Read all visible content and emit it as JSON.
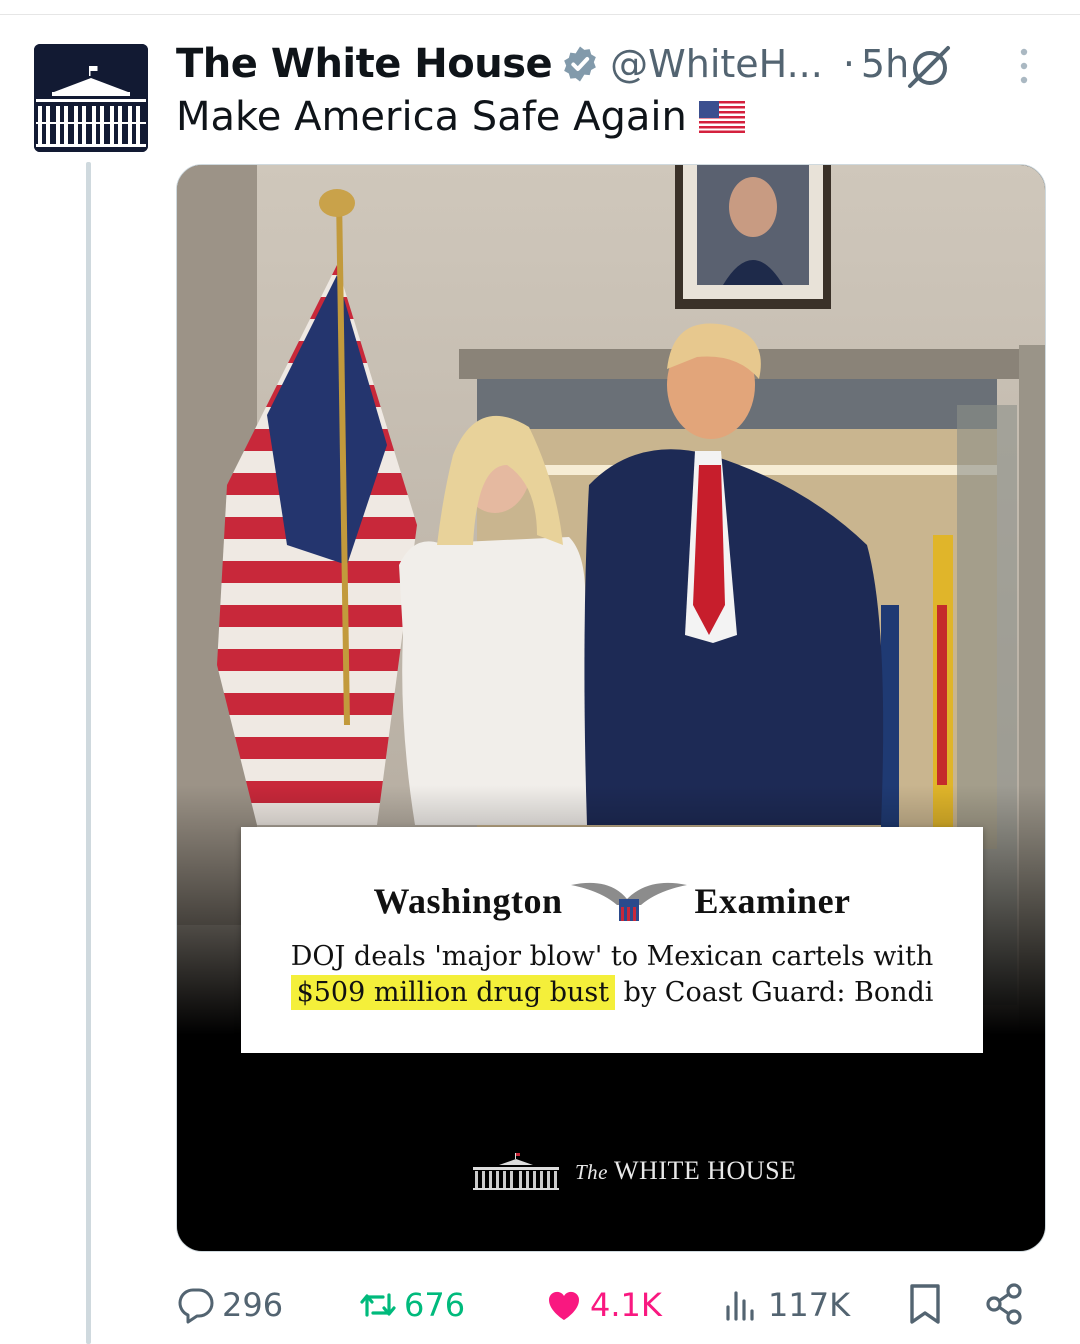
{
  "tweet": {
    "display_name": "The White House",
    "handle": "@WhiteH...",
    "separator": "·",
    "time": "5h",
    "text": "Make America Safe Again",
    "verified_icon": "verified-badge-icon",
    "emoji": "us-flag-icon"
  },
  "media": {
    "masthead_left": "Washington",
    "masthead_right": "Examiner",
    "headline_line1": "DOJ deals 'major blow' to Mexican cartels with",
    "headline_highlight": "$509 million drug bust",
    "headline_rest": "by Coast Guard: Bondi",
    "watermark_prefix": "The",
    "watermark_text": "WHITE HOUSE"
  },
  "actions": {
    "replies": "296",
    "reposts": "676",
    "likes": "4.1K",
    "views": "117K"
  },
  "colors": {
    "repost": "#00ba7c",
    "like": "#f91880",
    "muted": "#536471",
    "verified": "#829aab",
    "highlight": "#f4ef3a"
  }
}
